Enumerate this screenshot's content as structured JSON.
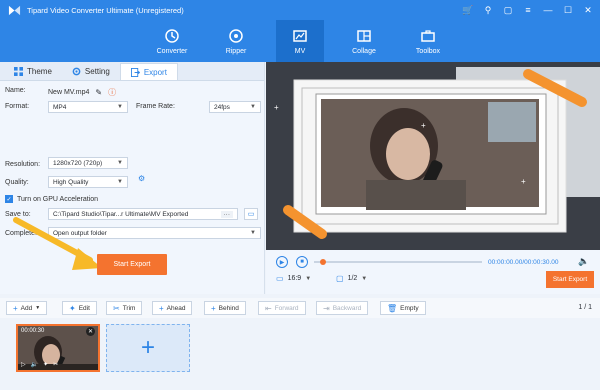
{
  "app": {
    "title": "Tipard Video Converter Ultimate (Unregistered)"
  },
  "nav": {
    "tabs": [
      "Converter",
      "Ripper",
      "MV",
      "Collage",
      "Toolbox"
    ],
    "active": "MV"
  },
  "left_tabs": [
    "Theme",
    "Setting",
    "Export"
  ],
  "export": {
    "name_label": "Name:",
    "name_value": "New MV.mp4",
    "format_label": "Format:",
    "format_value": "MP4",
    "frame_rate_label": "Frame Rate:",
    "frame_rate_value": "24fps",
    "resolution_label": "Resolution:",
    "resolution_value": "1280x720 (720p)",
    "quality_label": "Quality:",
    "quality_value": "High Quality",
    "gpu_label": "Turn on GPU Acceleration",
    "save_to_label": "Save to:",
    "save_to_value": "C:\\Tipard Studio\\Tipar...r Ultimate\\MV Exported",
    "browse_label": "···",
    "complete_label": "Complete:",
    "complete_value": "Open output folder",
    "start_export_label": "Start Export"
  },
  "player": {
    "time": "00:00:00.00/00:00:30.00",
    "aspect": "16:9",
    "pages": "1/2",
    "start_export_label": "Start Export"
  },
  "toolbar": {
    "add": "Add",
    "edit": "Edit",
    "trim": "Trim",
    "ahead": "Ahead",
    "behind": "Behind",
    "forward": "Forward",
    "backward": "Backward",
    "empty": "Empty",
    "page": "1 / 1"
  },
  "timeline": {
    "clip_duration": "00:00:30"
  },
  "colors": {
    "brand": "#2e85e6",
    "accent": "#f4732f"
  }
}
